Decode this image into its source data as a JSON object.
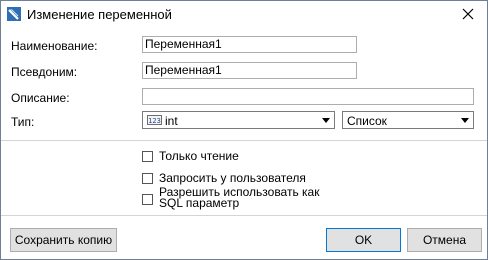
{
  "window": {
    "title": "Изменение переменной"
  },
  "form": {
    "name_label": "Наименование:",
    "name_value": "Переменная1",
    "alias_label": "Псевдоним:",
    "alias_value": "Переменная1",
    "description_label": "Описание:",
    "description_value": "",
    "type_label": "Тип:",
    "type_value": "int",
    "type_icon_text": "123",
    "kind_value": "Список"
  },
  "options": {
    "readonly_label": "Только чтение",
    "readonly_checked": false,
    "ask_user_label": "Запросить у пользователя",
    "ask_user_checked": false,
    "sql_param_label": "Разрешить использовать как SQL параметр",
    "sql_param_checked": false
  },
  "buttons": {
    "save_copy": "Сохранить копию",
    "ok": "OK",
    "cancel": "Отмена"
  },
  "icons": {
    "app": "app-icon",
    "close": "close-icon",
    "dropdown": "chevron-down-icon"
  }
}
